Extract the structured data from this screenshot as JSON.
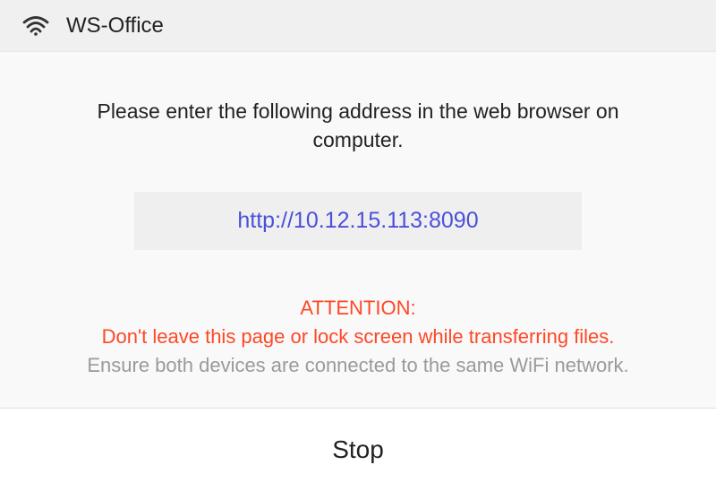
{
  "status_bar": {
    "network_name": "WS-Office"
  },
  "content": {
    "instruction": "Please enter the following address in the web browser on computer.",
    "address_url": "http://10.12.15.113:8090",
    "attention_label": "ATTENTION:",
    "attention_warning": "Don't leave this page or lock screen while transferring files.",
    "attention_note": "Ensure both devices are connected to the same WiFi network."
  },
  "bottom": {
    "stop_label": "Stop"
  }
}
